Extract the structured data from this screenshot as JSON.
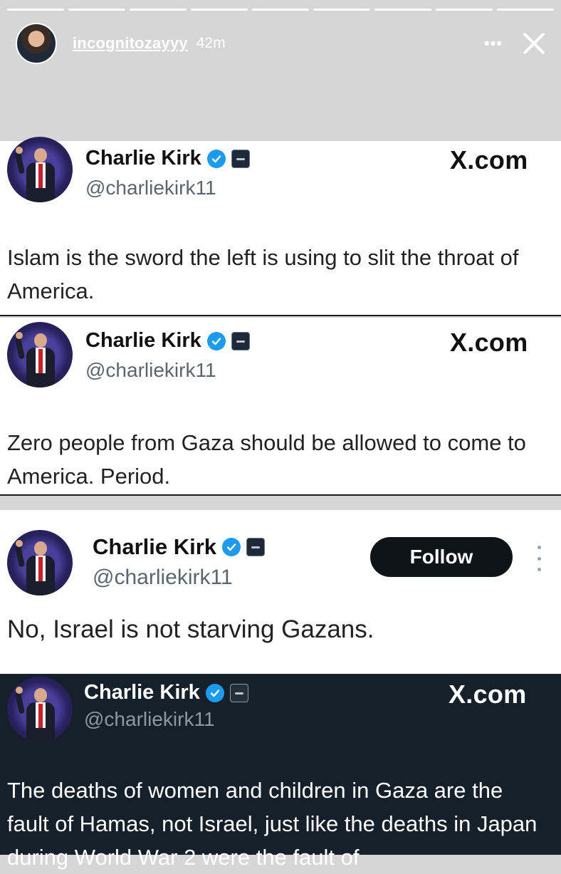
{
  "story": {
    "progress_segments": 9,
    "username": "incognitozayyy",
    "time": "42m",
    "more_label": "•••"
  },
  "tweets": [
    {
      "name": "Charlie Kirk",
      "handle": "@charliekirk11",
      "source": "X.com",
      "text": "Islam is the sword the left is using to slit the throat of America."
    },
    {
      "name": "Charlie Kirk",
      "handle": "@charliekirk11",
      "source": "X.com",
      "text": "Zero people from Gaza should be allowed to come to America. Period."
    },
    {
      "name": "Charlie Kirk",
      "handle": "@charliekirk11",
      "follow_label": "Follow",
      "text": "No, Israel is not starving Gazans."
    },
    {
      "name": "Charlie Kirk",
      "handle": "@charliekirk11",
      "source": "X.com",
      "text": "The deaths of women and children in Gaza are the fault of Hamas, not Israel, just like the deaths in Japan during World War 2 were the fault of"
    }
  ],
  "colors": {
    "verified": "#1d9bf0",
    "dark_card": "#15202b",
    "follow_button": "#0f1419"
  }
}
